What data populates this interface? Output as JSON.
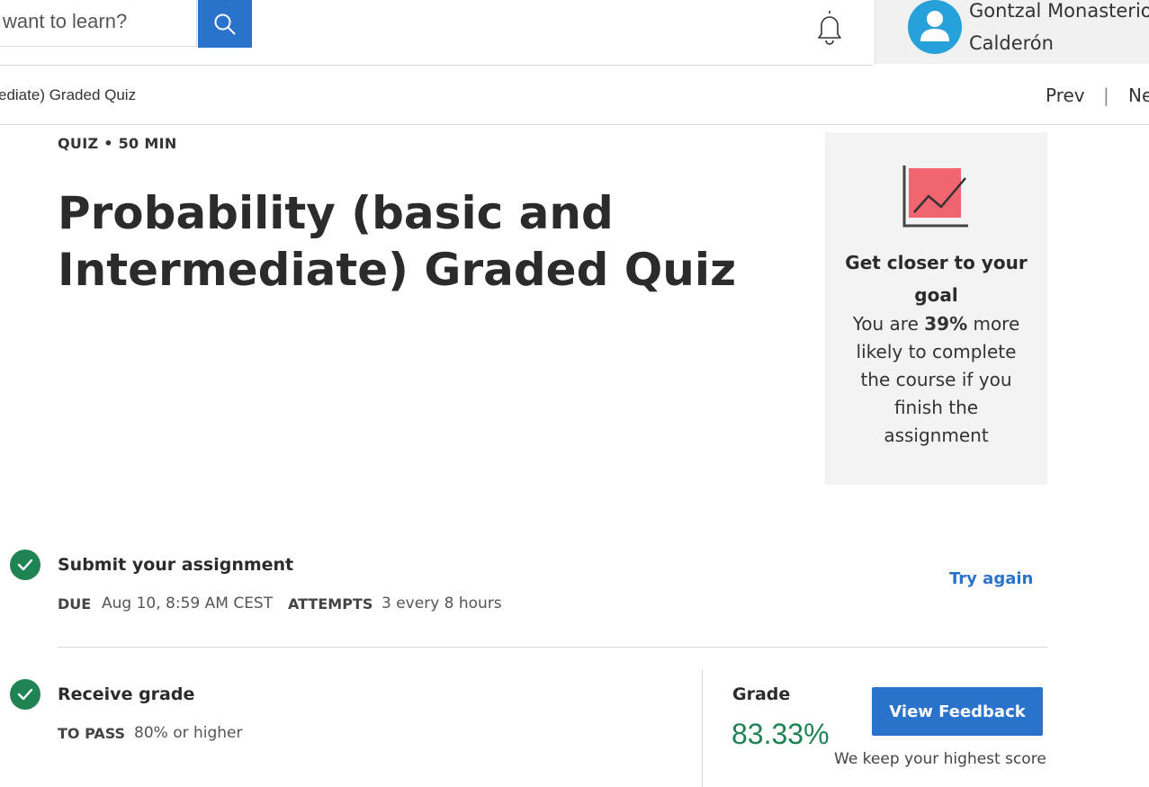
{
  "header": {
    "search_placeholder_visible": "want to learn?",
    "user_name_line1": "Gontzal Monasterio",
    "user_name_line2": "Calderón"
  },
  "breadcrumb": {
    "current": "ediate) Graded Quiz",
    "prev_label": "Prev",
    "separator": "|",
    "next_label": "Ne"
  },
  "quiz": {
    "meta": "QUIZ • 50 MIN",
    "title": "Probability (basic and Intermediate) Graded Quiz"
  },
  "side_card": {
    "heading": "Get closer to your goal",
    "body_prefix": "You are ",
    "body_percent": "39%",
    "body_suffix": " more likely to complete the course if you finish the assignment"
  },
  "submit_step": {
    "title": "Submit your assignment",
    "due_label": "DUE",
    "due_value": "Aug 10, 8:59 AM CEST",
    "attempts_label": "ATTEMPTS",
    "attempts_value": "3 every 8 hours",
    "try_again_label": "Try again"
  },
  "grade_step": {
    "title": "Receive grade",
    "to_pass_label": "TO PASS",
    "to_pass_value": "80% or higher",
    "grade_label": "Grade",
    "grade_value": "83.33%",
    "view_feedback_label": "View Feedback",
    "keep_note": "We keep your highest score"
  },
  "colors": {
    "accent_blue": "#2a73cc",
    "success_green": "#1f8354",
    "avatar_blue": "#27a1d9",
    "card_chart_red": "#f06570"
  },
  "icons": [
    "search-icon",
    "bell-icon",
    "user-avatar-icon",
    "chart-goal-icon",
    "check-icon"
  ]
}
